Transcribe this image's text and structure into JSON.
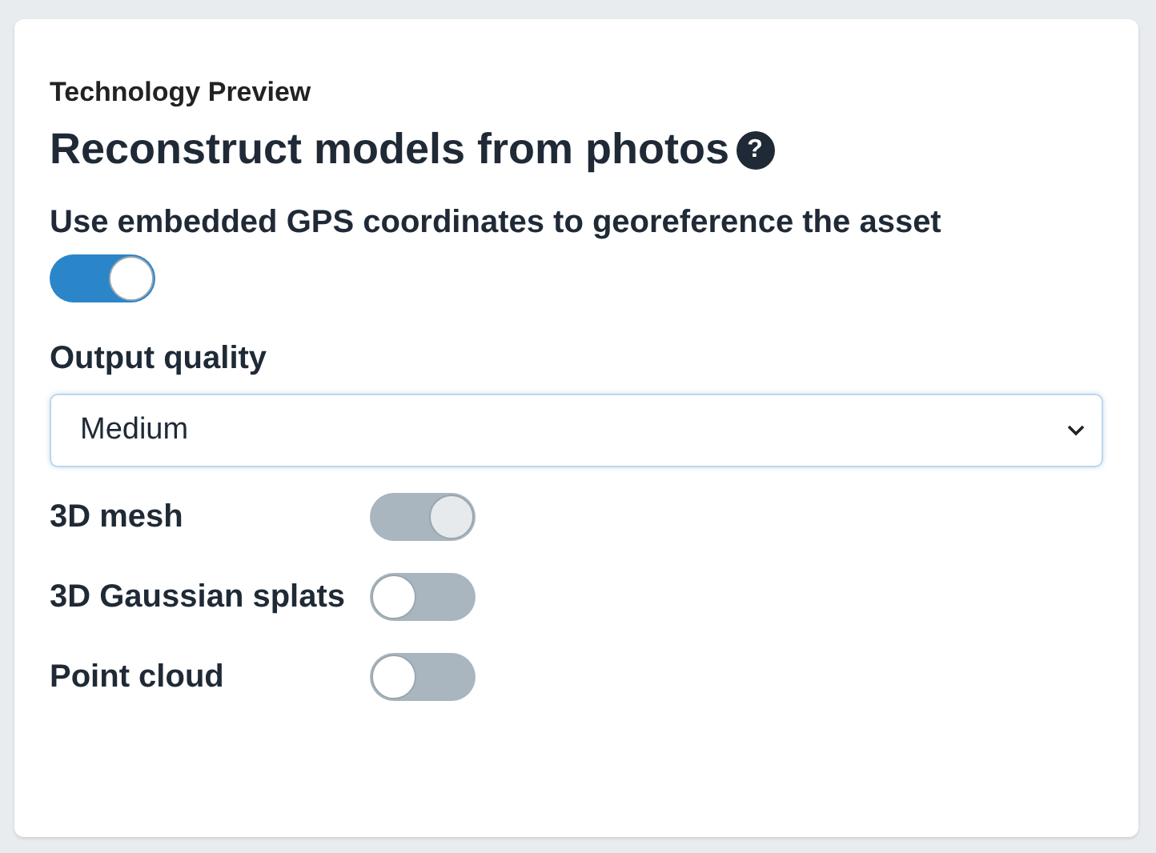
{
  "eyebrow": "Technology Preview",
  "title": "Reconstruct models from photos",
  "help_icon": "?",
  "gps": {
    "label": "Use embedded GPS coordinates to georeference the asset",
    "on": true
  },
  "quality": {
    "label": "Output quality",
    "value": "Medium"
  },
  "outputs": [
    {
      "label": "3D mesh",
      "on": true,
      "disabled": true
    },
    {
      "label": "3D Gaussian splats",
      "on": false,
      "disabled": false
    },
    {
      "label": "Point cloud",
      "on": false,
      "disabled": false
    }
  ]
}
